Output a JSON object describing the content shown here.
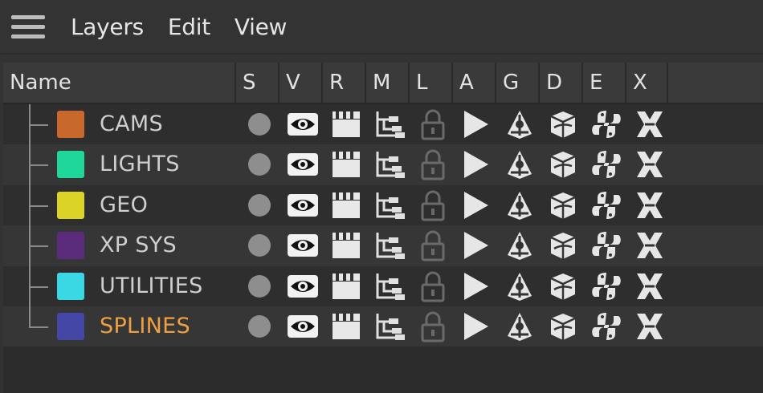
{
  "menu": {
    "icon": "hamburger-menu-icon",
    "items": [
      "Layers",
      "Edit",
      "View"
    ]
  },
  "columns": [
    "Name",
    "S",
    "V",
    "R",
    "M",
    "L",
    "A",
    "G",
    "D",
    "E",
    "X"
  ],
  "column_icons": {
    "S": "solo-dot-icon",
    "V": "eye-icon",
    "R": "clapperboard-icon",
    "M": "hierarchy-icon",
    "L": "lock-icon",
    "A": "play-icon",
    "G": "generator-icon",
    "D": "deformer-cube-icon",
    "E": "python-icon",
    "X": "xpresso-icon"
  },
  "layers": [
    {
      "name": "CAMS",
      "color": "#c8682c",
      "active": false
    },
    {
      "name": "LIGHTS",
      "color": "#1fd79b",
      "active": false
    },
    {
      "name": "GEO",
      "color": "#dcd327",
      "active": false
    },
    {
      "name": "XP SYS",
      "color": "#5c2c7c",
      "active": false
    },
    {
      "name": "UTILITIES",
      "color": "#3ad8e4",
      "active": false
    },
    {
      "name": "SPLINES",
      "color": "#4547a7",
      "active": true
    }
  ],
  "colors": {
    "active_text": "#f0a040",
    "text": "#cfcfcf",
    "background": "#333333"
  }
}
